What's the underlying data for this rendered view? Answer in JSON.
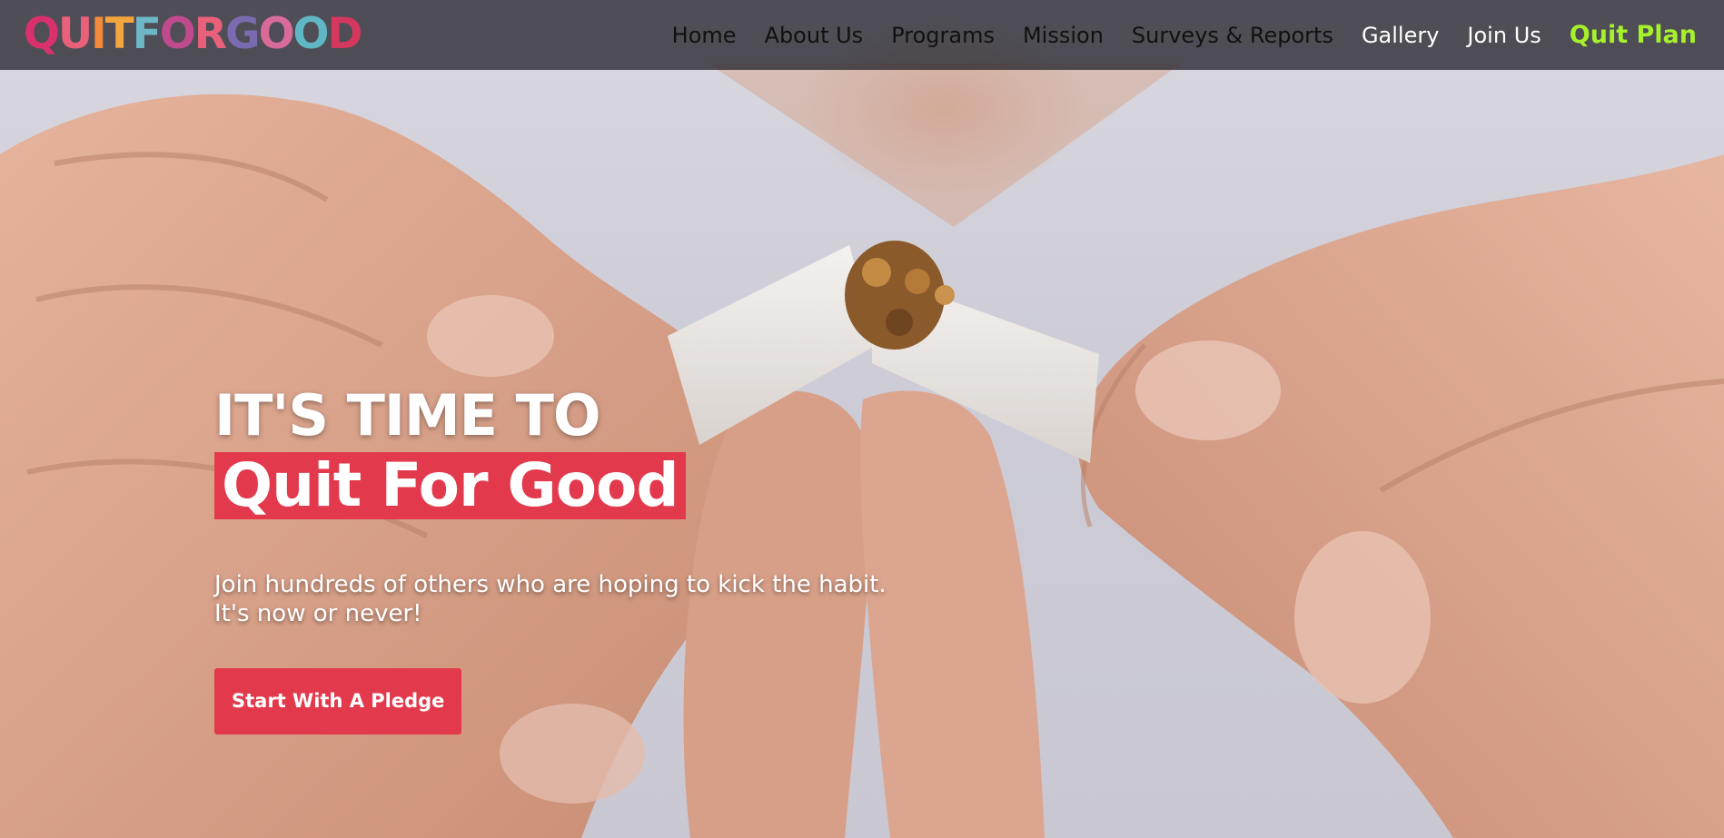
{
  "logo": {
    "letters": [
      "Q",
      "U",
      "I",
      "T",
      "F",
      "O",
      "R",
      "G",
      "O",
      "O",
      "D"
    ],
    "colors": [
      "#d9316e",
      "#e8607a",
      "#f28a3a",
      "#f4a53d",
      "#6eb7c6",
      "#c04a8e",
      "#e8607a",
      "#7a6bb0",
      "#d86b9a",
      "#5fb6c4",
      "#d4385f"
    ]
  },
  "nav": {
    "items": [
      {
        "label": "Home",
        "style": "dark"
      },
      {
        "label": "About Us",
        "style": "dark"
      },
      {
        "label": "Programs",
        "style": "dark"
      },
      {
        "label": "Mission",
        "style": "dark"
      },
      {
        "label": "Surveys & Reports",
        "style": "dark"
      },
      {
        "label": "Gallery",
        "style": "light"
      },
      {
        "label": "Join Us",
        "style": "light"
      },
      {
        "label": "Quit Plan",
        "style": "cta"
      }
    ]
  },
  "hero": {
    "eyebrow": "IT'S TIME TO",
    "headline": "Quit For Good",
    "subtitle_line1": "Join hundreds of others who are hoping to kick the habit.",
    "subtitle_line2": "It's now or never!",
    "button_label": "Start With A Pledge"
  },
  "colors": {
    "accent_red": "#e23a4c",
    "cta_green": "#a6f12b",
    "nav_bg": "#28262e"
  }
}
